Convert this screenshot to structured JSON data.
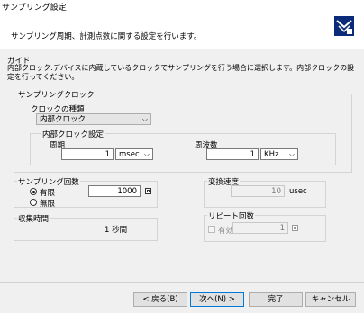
{
  "window": {
    "title": "サンプリング設定"
  },
  "header": {
    "description": "サンプリング周期、計測点数に関する設定を行います。"
  },
  "guide": {
    "label": "ガイド",
    "line1": "内部クロック:デバイスに内蔵しているクロックでサンプリングを行う場合に選択します。内部クロックの設",
    "line2": "定を行ってください。"
  },
  "sampling_clock": {
    "label": "サンプリングクロック",
    "type_label": "クロックの種類",
    "type_value": "内部クロック",
    "internal": {
      "label": "内部クロック設定",
      "period_label": "周期",
      "period_value": "1",
      "period_unit": "msec",
      "freq_label": "周波数",
      "freq_value": "1",
      "freq_unit": "KHz"
    }
  },
  "sampling_count": {
    "label": "サンプリング回数",
    "finite_label": "有限",
    "infinite_label": "無限",
    "count_value": "1000",
    "selected": "finite"
  },
  "conversion": {
    "label": "変換速度",
    "value": "10",
    "unit": "usec"
  },
  "collection": {
    "label": "収集時間",
    "value": "1 秒間"
  },
  "repeat": {
    "label": "リピート回数",
    "enable_label": "有効",
    "value": "1"
  },
  "footer": {
    "back": "< 戻る(B)",
    "next": "次へ(N) >",
    "finish": "完了",
    "cancel": "キャンセル"
  }
}
